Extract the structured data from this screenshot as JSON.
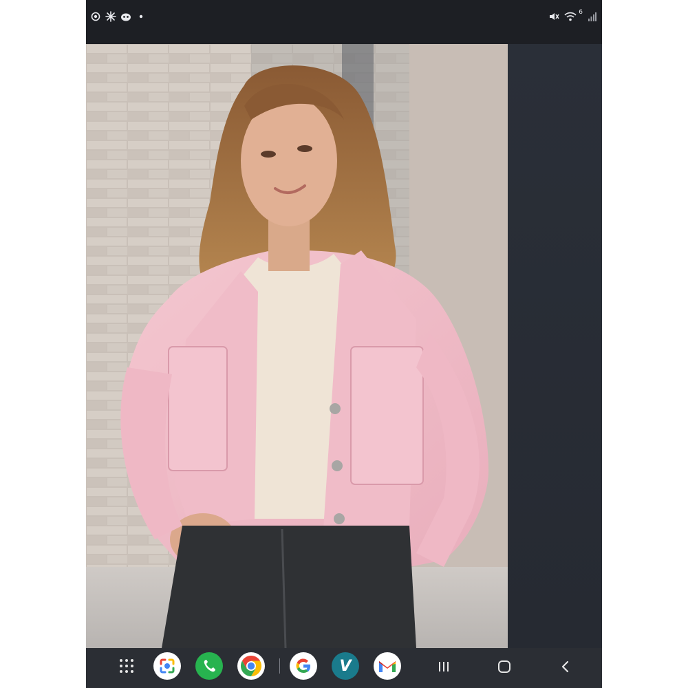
{
  "status_bar": {
    "left_icons": [
      "camera-icon",
      "sparkle-icon",
      "face-icon",
      "dot-icon"
    ],
    "right_icons": [
      "mute-icon",
      "wifi-icon",
      "signal-icon"
    ],
    "wifi_badge": "6"
  },
  "viewer": {
    "image_name": "photo-woman-pink-denim-jacket",
    "side_panel_color": "#262a32"
  },
  "nav_bar": {
    "dock_apps": [
      "app-drawer-icon",
      "google-lens-icon",
      "phone-icon",
      "chrome-icon",
      "google-icon",
      "venmo-icon",
      "gmail-icon"
    ],
    "system_buttons": [
      "recents-button",
      "home-button",
      "back-button"
    ],
    "venmo_letter": "V",
    "colors": {
      "phone_green": "#27b34f",
      "venmo_teal": "#1a7b8c",
      "gmail_red": "#ea4335",
      "google_blue": "#4285f4",
      "google_yellow": "#fbbc05",
      "google_green": "#34a853"
    }
  }
}
